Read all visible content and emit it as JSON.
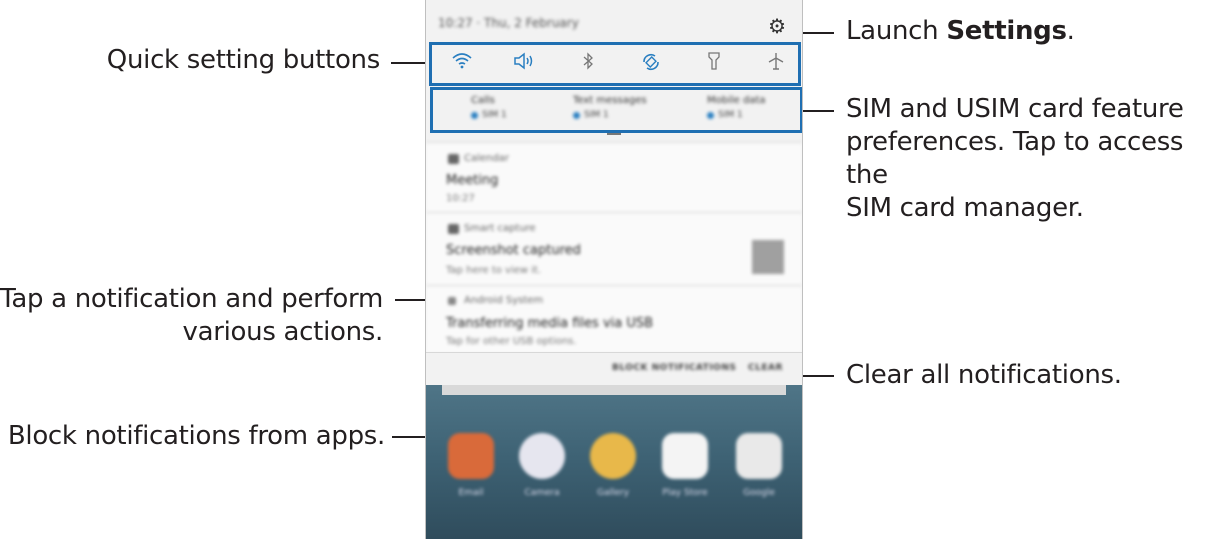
{
  "callouts": {
    "quick_settings": "Quick setting buttons",
    "tap_notification_line1": "Tap a notification and perform",
    "tap_notification_line2": "various actions.",
    "block_notifications": "Block notifications from apps.",
    "launch_prefix": "Launch ",
    "launch_bold": "Settings",
    "launch_suffix": ".",
    "sim_line1": "SIM and USIM card feature",
    "sim_line2": "preferences. Tap to access the",
    "sim_line3": "SIM card manager.",
    "clear_all": "Clear all notifications."
  },
  "phone": {
    "status_time": "10:27 · Thu, 2 February",
    "quick_settings_icons": [
      "wifi-icon",
      "sound-icon",
      "bluetooth-icon",
      "auto-rotate-icon",
      "flashlight-icon",
      "airplane-mode-icon"
    ],
    "sim_prefs": [
      {
        "title": "Calls",
        "value": "SIM 1"
      },
      {
        "title": "Text messages",
        "value": "SIM 1"
      },
      {
        "title": "Mobile data",
        "value": "SIM 1"
      }
    ],
    "notifications": [
      {
        "app": "Calendar",
        "title": "Meeting",
        "sub": "10:27"
      },
      {
        "app": "Smart capture",
        "title": "Screenshot captured",
        "sub": "Tap here to view it."
      },
      {
        "app": "Android System",
        "title": "Transferring media files via USB",
        "sub": "Tap for other USB options."
      }
    ],
    "actions": {
      "block": "BLOCK NOTIFICATIONS",
      "clear": "CLEAR"
    },
    "apps": [
      "Email",
      "Camera",
      "Gallery",
      "Play Store",
      "Google"
    ]
  },
  "colors": {
    "highlight": "#1f6fb2",
    "icon_blue": "#2a7fc1"
  }
}
